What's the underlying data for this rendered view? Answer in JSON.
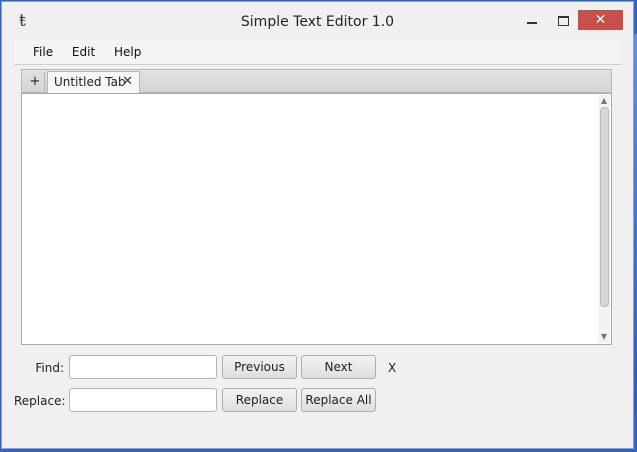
{
  "window": {
    "title": "Simple Text Editor 1.0",
    "app_icon_glyph": "ŧ",
    "minimize_icon": "minimize-icon",
    "maximize_icon": "maximize-icon",
    "close_glyph": "✕"
  },
  "menu": {
    "items": [
      {
        "label": "File"
      },
      {
        "label": "Edit"
      },
      {
        "label": "Help"
      }
    ]
  },
  "tabs": {
    "add_label": "+",
    "items": [
      {
        "label": "Untitled Tab",
        "close_glyph": "✕"
      }
    ]
  },
  "editor": {
    "content": "",
    "scroll_up_glyph": "▲",
    "scroll_down_glyph": "▼"
  },
  "find": {
    "label": "Find:",
    "value": "",
    "previous_label": "Previous",
    "next_label": "Next",
    "close_label": "X"
  },
  "replace": {
    "label": "Replace:",
    "value": "",
    "replace_label": "Replace",
    "replace_all_label": "Replace All"
  },
  "colors": {
    "desktop": "#2f63c7",
    "window_bg": "#f0f0f0",
    "close_button": "#c7504b"
  }
}
